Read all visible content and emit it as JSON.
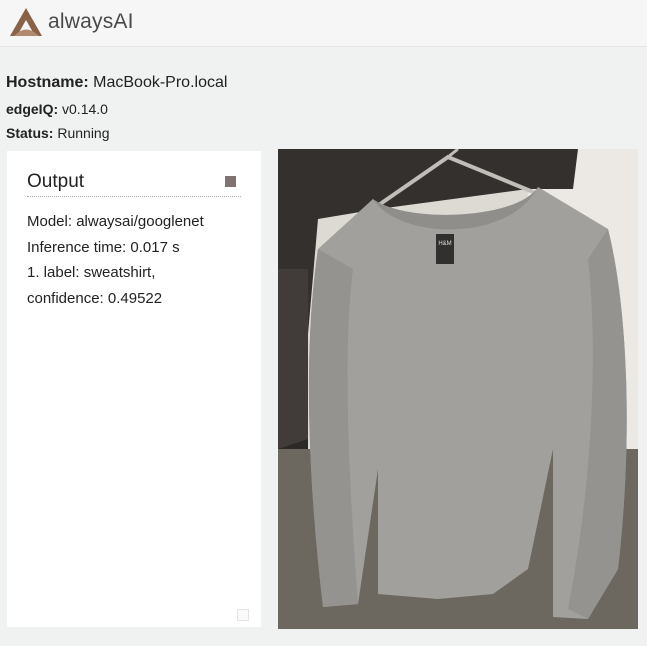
{
  "brand": {
    "name": "alwaysAI"
  },
  "info": {
    "hostname_label": "Hostname:",
    "hostname_value": "MacBook-Pro.local",
    "edgeiq_label": "edgeIQ:",
    "edgeiq_value": "v0.14.0",
    "status_label": "Status:",
    "status_value": "Running"
  },
  "output": {
    "title": "Output",
    "lines": [
      "Model: alwaysai/googlenet",
      "Inference time: 0.017 s",
      "1. label: sweatshirt,",
      "confidence: 0.49522"
    ]
  },
  "image": {
    "content": "sweatshirt-on-hanger",
    "garment_tag": "H&M"
  },
  "colors": {
    "logo_brown": "#8a6248",
    "stop_button": "#7f7471",
    "page_bg": "#f0f2f1"
  }
}
